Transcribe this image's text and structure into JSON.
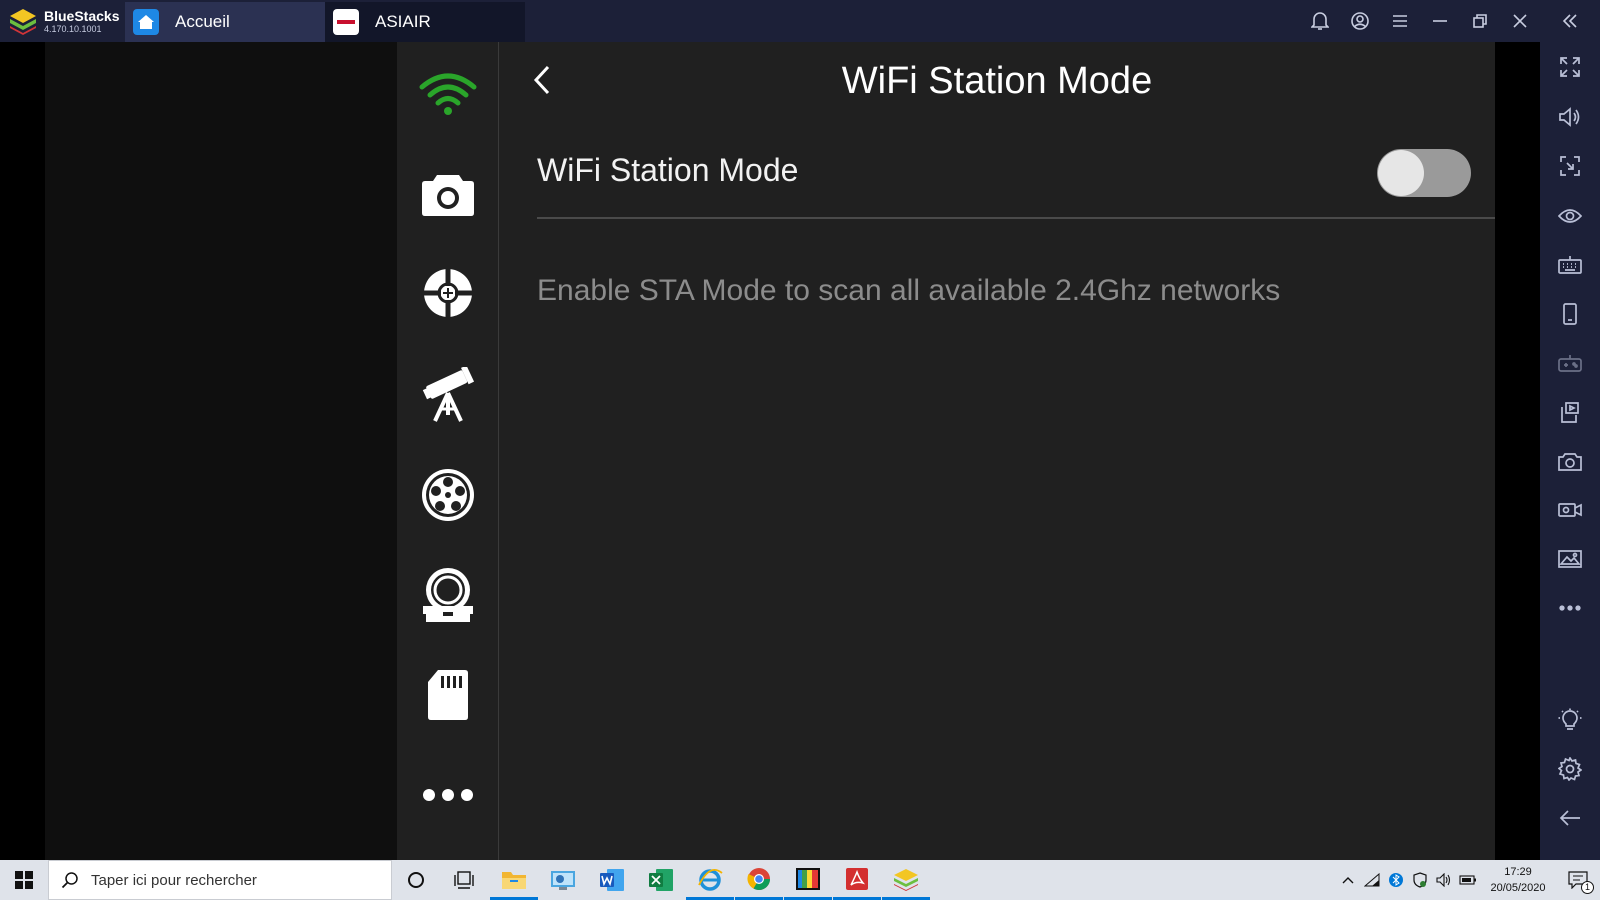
{
  "titlebar": {
    "brand_name": "BlueStacks",
    "brand_version": "4.170.10.1001",
    "tabs": [
      {
        "label": "Accueil",
        "icon": "home-icon"
      },
      {
        "label": "ASIAIR",
        "icon": "asiair-app-icon"
      }
    ],
    "controls": [
      "bell-icon",
      "account-icon",
      "menu-icon",
      "minimize-icon",
      "restore-icon",
      "close-icon",
      "collapse-sidebar-icon"
    ]
  },
  "app": {
    "title": "WiFi Station Mode",
    "setting": {
      "label": "WiFi Station Mode",
      "toggle_on": false
    },
    "hint": "Enable STA Mode to scan all available 2.4Ghz networks",
    "side_nav": [
      "wifi-icon",
      "camera-icon",
      "guide-crosshair-icon",
      "telescope-icon",
      "filter-wheel-icon",
      "focuser-icon",
      "sd-card-icon",
      "more-icon"
    ],
    "colors": {
      "wifi_green": "#2aa52a",
      "panel_bg": "#202020"
    }
  },
  "right_toolbar": [
    "fullscreen-icon",
    "volume-icon",
    "screen-crop-icon",
    "eye-icon",
    "keyboard-icon",
    "phone-rotate-icon",
    "gamepad-icon",
    "install-apk-icon",
    "screenshot-icon",
    "record-video-icon",
    "media-folder-icon",
    "more-options-icon",
    "light-bulb-icon",
    "settings-gear-icon",
    "back-arrow-icon"
  ],
  "taskbar": {
    "search_placeholder": "Taper ici pour rechercher",
    "time": "17:29",
    "date": "20/05/2020",
    "notification_count": "1"
  }
}
